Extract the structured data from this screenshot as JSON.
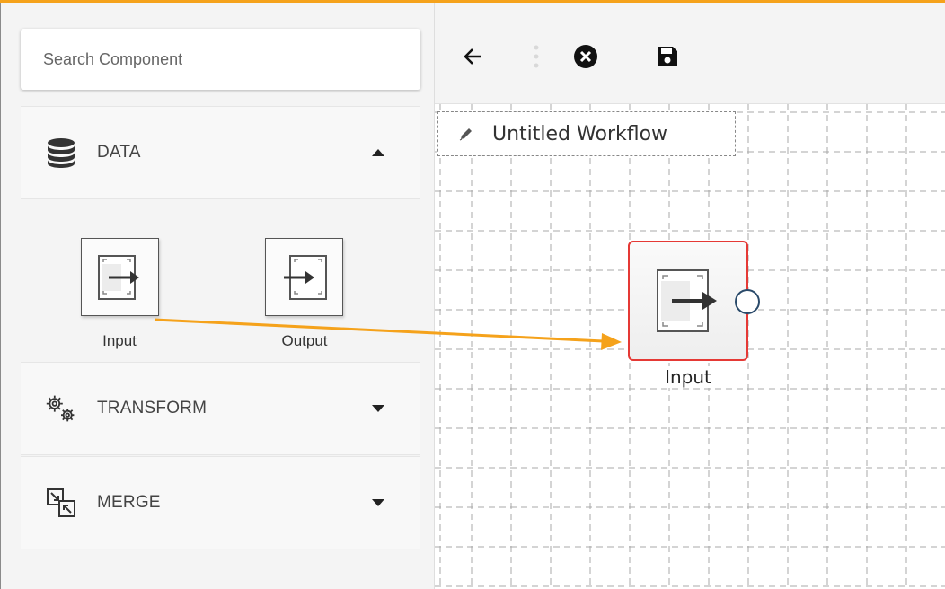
{
  "search": {
    "placeholder": "Search Component"
  },
  "sections": {
    "data": {
      "label": "DATA",
      "icon": "database-icon",
      "expanded": true
    },
    "transform": {
      "label": "TRANSFORM",
      "icon": "gears-icon",
      "expanded": false
    },
    "merge": {
      "label": "MERGE",
      "icon": "merge-icon",
      "expanded": false
    }
  },
  "data_components": [
    {
      "label": "Input",
      "icon": "input-arrow-icon"
    },
    {
      "label": "Output",
      "icon": "output-arrow-icon"
    }
  ],
  "toolbar": {
    "back_icon": "arrow-left-icon",
    "close_icon": "close-circle-icon",
    "save_icon": "save-icon"
  },
  "workflow": {
    "title": "Untitled Workflow"
  },
  "canvas_node": {
    "label": "Input",
    "icon": "input-arrow-icon"
  },
  "colors": {
    "accent": "#f5a21b",
    "drag_arrow": "#f5a21b",
    "node_border": "#e53935",
    "port_border": "#2a4a6a"
  }
}
